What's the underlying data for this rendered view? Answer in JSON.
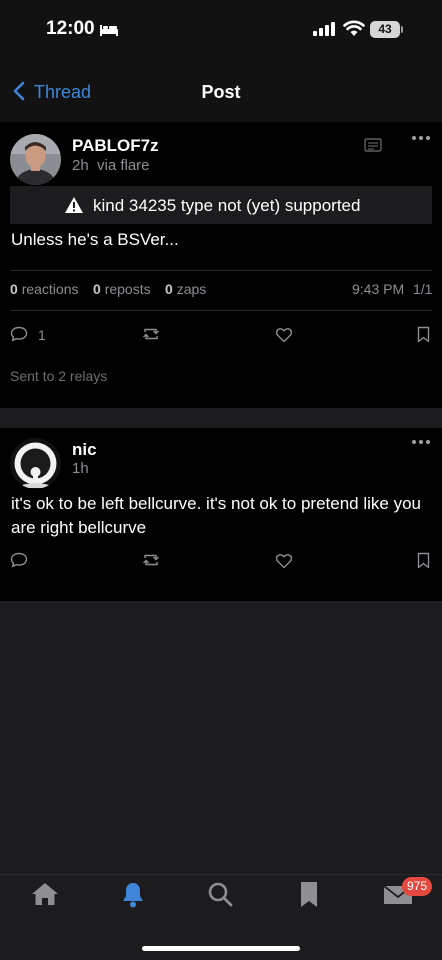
{
  "status_bar": {
    "time": "12:00",
    "battery": "43"
  },
  "nav": {
    "back_label": "Thread",
    "title": "Post"
  },
  "post1": {
    "username": "PABLOF7z",
    "age": "2h",
    "via": "via flare",
    "warning": "kind 34235 type not (yet) supported",
    "content": "Unless he's a BSVer...",
    "reactions_count": "0",
    "reactions_label": "reactions",
    "reposts_count": "0",
    "reposts_label": "reposts",
    "zaps_count": "0",
    "zaps_label": "zaps",
    "timestamp": "9:43 PM",
    "page_indicator": "1/1",
    "reply_count": "1",
    "relays_text": "Sent to 2 relays"
  },
  "post2": {
    "username": "nic",
    "age": "1h",
    "content": "it's ok to be left bellcurve. it's not ok to pretend like you are right bellcurve"
  },
  "tabbar": {
    "notification_badge": "975"
  },
  "colors": {
    "accent": "#3f86d8",
    "badge": "#e5483f",
    "background": "#1c1c1e",
    "card": "#000000"
  }
}
